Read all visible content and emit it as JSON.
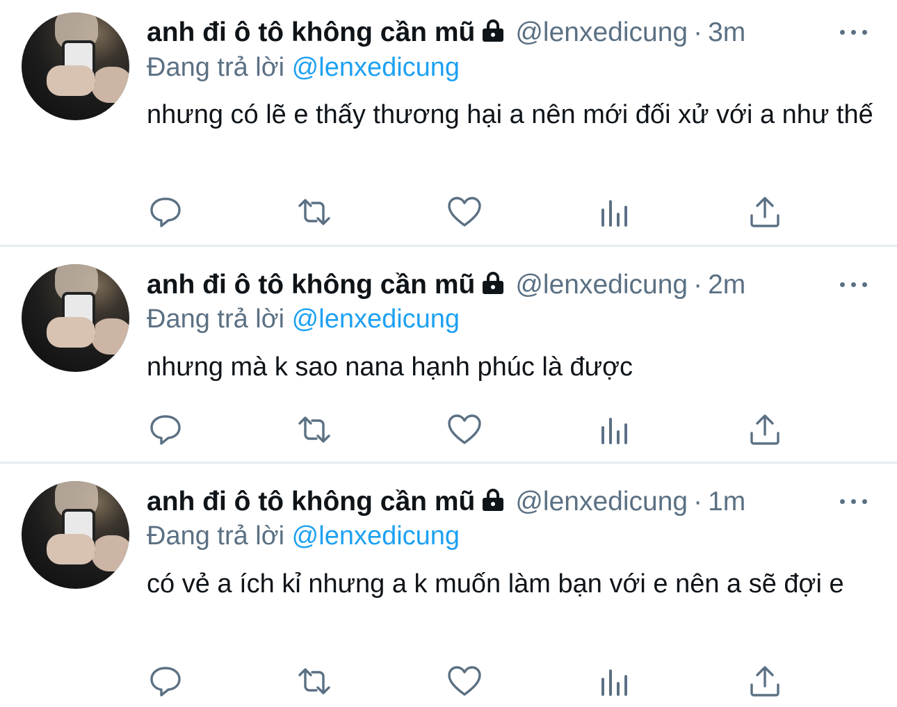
{
  "colors": {
    "accent": "#1da1f2",
    "secondary": "#5b7083",
    "divider": "#e6ecf0"
  },
  "tweets": [
    {
      "name": "anh đi ô tô không cần mũ",
      "handle": "@lenxedicung",
      "separator": "·",
      "time": "3m",
      "replying_label": "Đang trả lời",
      "replying_to": "@lenxedicung",
      "text": "nhưng có lẽ e thấy thương hại a nên mới đối xử với a như thế"
    },
    {
      "name": "anh đi ô tô không cần mũ",
      "handle": "@lenxedicung",
      "separator": "·",
      "time": "2m",
      "replying_label": "Đang trả lời",
      "replying_to": "@lenxedicung",
      "text": "nhưng mà k sao nana hạnh phúc là được"
    },
    {
      "name": "anh đi ô tô không cần mũ",
      "handle": "@lenxedicung",
      "separator": "·",
      "time": "1m",
      "replying_label": "Đang trả lời",
      "replying_to": "@lenxedicung",
      "text": "có vẻ a ích kỉ nhưng a k muốn làm bạn với e nên a sẽ đợi e"
    }
  ],
  "icons": {
    "avatar": "profile-photo",
    "lock": "lock-icon",
    "more": "more-icon",
    "reply": "reply-icon",
    "retweet": "retweet-icon",
    "like": "heart-icon",
    "analytics": "analytics-icon",
    "share": "share-icon"
  }
}
